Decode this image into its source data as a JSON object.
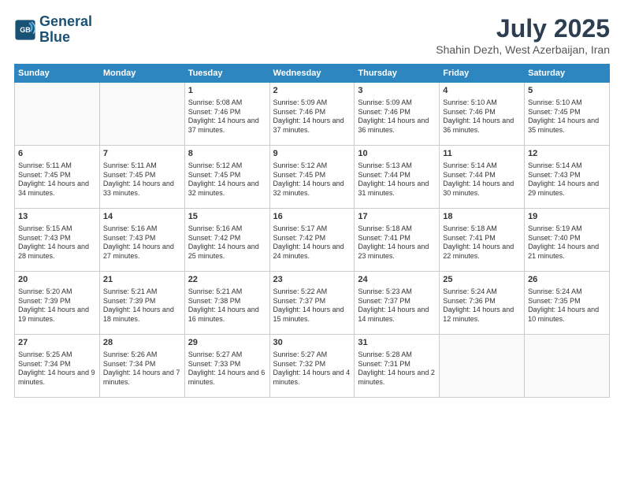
{
  "header": {
    "logo_line1": "General",
    "logo_line2": "Blue",
    "month_title": "July 2025",
    "location": "Shahin Dezh, West Azerbaijan, Iran"
  },
  "weekdays": [
    "Sunday",
    "Monday",
    "Tuesday",
    "Wednesday",
    "Thursday",
    "Friday",
    "Saturday"
  ],
  "weeks": [
    [
      {
        "day": "",
        "content": ""
      },
      {
        "day": "",
        "content": ""
      },
      {
        "day": "1",
        "content": "Sunrise: 5:08 AM\nSunset: 7:46 PM\nDaylight: 14 hours and 37 minutes."
      },
      {
        "day": "2",
        "content": "Sunrise: 5:09 AM\nSunset: 7:46 PM\nDaylight: 14 hours and 37 minutes."
      },
      {
        "day": "3",
        "content": "Sunrise: 5:09 AM\nSunset: 7:46 PM\nDaylight: 14 hours and 36 minutes."
      },
      {
        "day": "4",
        "content": "Sunrise: 5:10 AM\nSunset: 7:46 PM\nDaylight: 14 hours and 36 minutes."
      },
      {
        "day": "5",
        "content": "Sunrise: 5:10 AM\nSunset: 7:45 PM\nDaylight: 14 hours and 35 minutes."
      }
    ],
    [
      {
        "day": "6",
        "content": "Sunrise: 5:11 AM\nSunset: 7:45 PM\nDaylight: 14 hours and 34 minutes."
      },
      {
        "day": "7",
        "content": "Sunrise: 5:11 AM\nSunset: 7:45 PM\nDaylight: 14 hours and 33 minutes."
      },
      {
        "day": "8",
        "content": "Sunrise: 5:12 AM\nSunset: 7:45 PM\nDaylight: 14 hours and 32 minutes."
      },
      {
        "day": "9",
        "content": "Sunrise: 5:12 AM\nSunset: 7:45 PM\nDaylight: 14 hours and 32 minutes."
      },
      {
        "day": "10",
        "content": "Sunrise: 5:13 AM\nSunset: 7:44 PM\nDaylight: 14 hours and 31 minutes."
      },
      {
        "day": "11",
        "content": "Sunrise: 5:14 AM\nSunset: 7:44 PM\nDaylight: 14 hours and 30 minutes."
      },
      {
        "day": "12",
        "content": "Sunrise: 5:14 AM\nSunset: 7:43 PM\nDaylight: 14 hours and 29 minutes."
      }
    ],
    [
      {
        "day": "13",
        "content": "Sunrise: 5:15 AM\nSunset: 7:43 PM\nDaylight: 14 hours and 28 minutes."
      },
      {
        "day": "14",
        "content": "Sunrise: 5:16 AM\nSunset: 7:43 PM\nDaylight: 14 hours and 27 minutes."
      },
      {
        "day": "15",
        "content": "Sunrise: 5:16 AM\nSunset: 7:42 PM\nDaylight: 14 hours and 25 minutes."
      },
      {
        "day": "16",
        "content": "Sunrise: 5:17 AM\nSunset: 7:42 PM\nDaylight: 14 hours and 24 minutes."
      },
      {
        "day": "17",
        "content": "Sunrise: 5:18 AM\nSunset: 7:41 PM\nDaylight: 14 hours and 23 minutes."
      },
      {
        "day": "18",
        "content": "Sunrise: 5:18 AM\nSunset: 7:41 PM\nDaylight: 14 hours and 22 minutes."
      },
      {
        "day": "19",
        "content": "Sunrise: 5:19 AM\nSunset: 7:40 PM\nDaylight: 14 hours and 21 minutes."
      }
    ],
    [
      {
        "day": "20",
        "content": "Sunrise: 5:20 AM\nSunset: 7:39 PM\nDaylight: 14 hours and 19 minutes."
      },
      {
        "day": "21",
        "content": "Sunrise: 5:21 AM\nSunset: 7:39 PM\nDaylight: 14 hours and 18 minutes."
      },
      {
        "day": "22",
        "content": "Sunrise: 5:21 AM\nSunset: 7:38 PM\nDaylight: 14 hours and 16 minutes."
      },
      {
        "day": "23",
        "content": "Sunrise: 5:22 AM\nSunset: 7:37 PM\nDaylight: 14 hours and 15 minutes."
      },
      {
        "day": "24",
        "content": "Sunrise: 5:23 AM\nSunset: 7:37 PM\nDaylight: 14 hours and 14 minutes."
      },
      {
        "day": "25",
        "content": "Sunrise: 5:24 AM\nSunset: 7:36 PM\nDaylight: 14 hours and 12 minutes."
      },
      {
        "day": "26",
        "content": "Sunrise: 5:24 AM\nSunset: 7:35 PM\nDaylight: 14 hours and 10 minutes."
      }
    ],
    [
      {
        "day": "27",
        "content": "Sunrise: 5:25 AM\nSunset: 7:34 PM\nDaylight: 14 hours and 9 minutes."
      },
      {
        "day": "28",
        "content": "Sunrise: 5:26 AM\nSunset: 7:34 PM\nDaylight: 14 hours and 7 minutes."
      },
      {
        "day": "29",
        "content": "Sunrise: 5:27 AM\nSunset: 7:33 PM\nDaylight: 14 hours and 6 minutes."
      },
      {
        "day": "30",
        "content": "Sunrise: 5:27 AM\nSunset: 7:32 PM\nDaylight: 14 hours and 4 minutes."
      },
      {
        "day": "31",
        "content": "Sunrise: 5:28 AM\nSunset: 7:31 PM\nDaylight: 14 hours and 2 minutes."
      },
      {
        "day": "",
        "content": ""
      },
      {
        "day": "",
        "content": ""
      }
    ]
  ]
}
